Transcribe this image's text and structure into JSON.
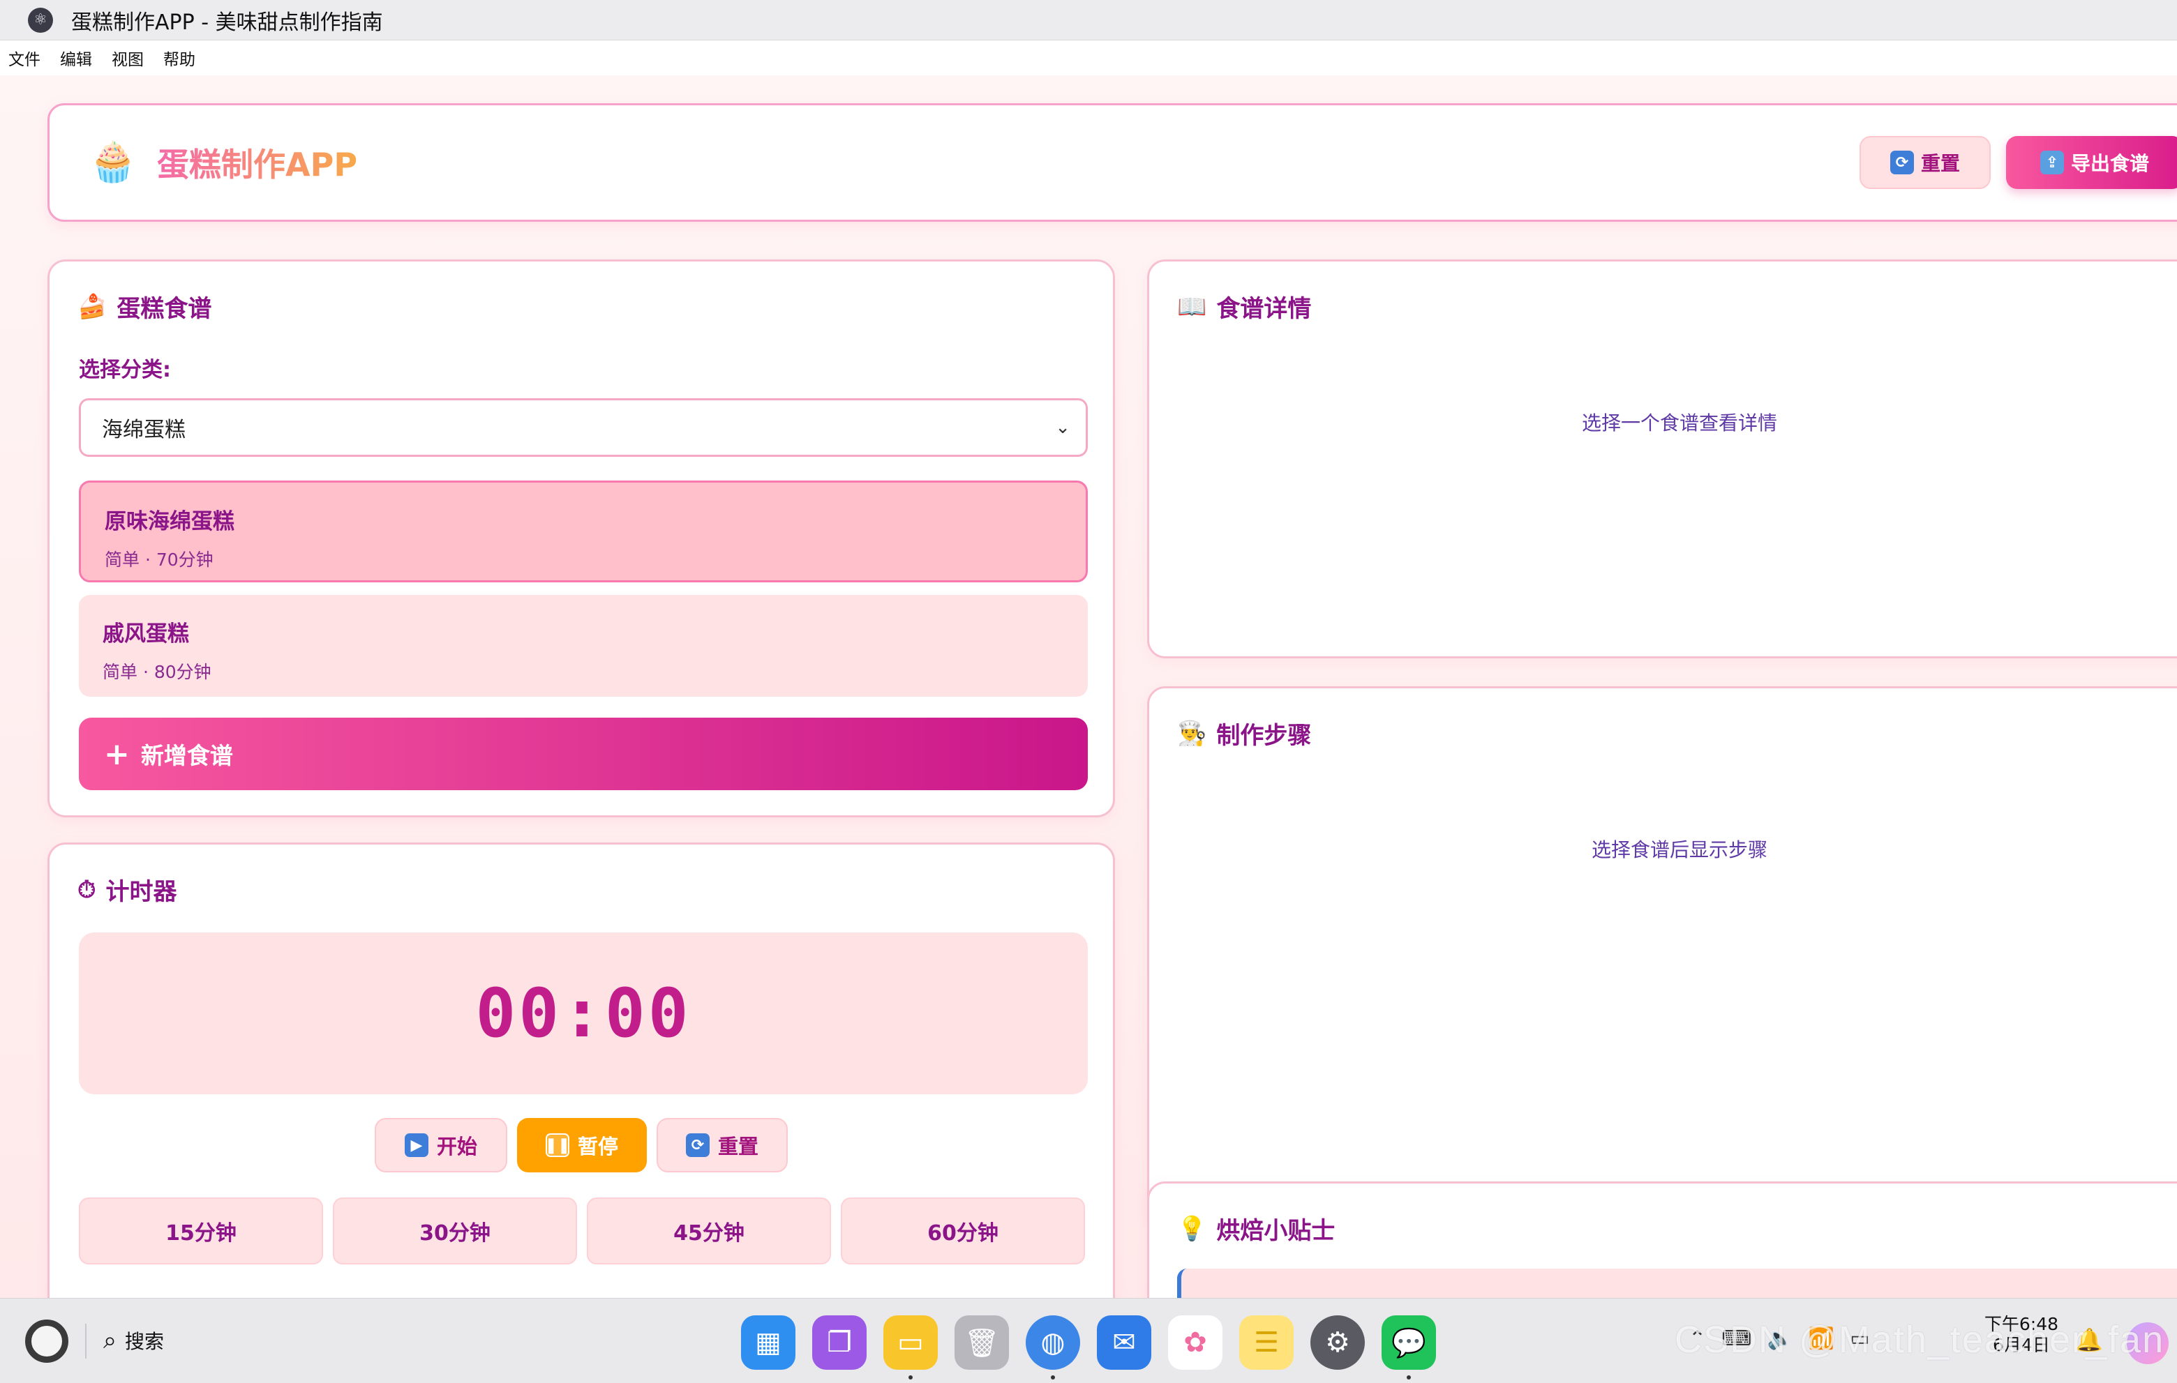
{
  "window": {
    "title": "蛋糕制作APP - 美味甜点制作指南"
  },
  "menu": [
    "文件",
    "编辑",
    "视图",
    "帮助"
  ],
  "header": {
    "logo_icon": "cupcake-icon",
    "app_title": "蛋糕制作APP",
    "reset_label": "重置",
    "export_label": "导出食谱"
  },
  "recipes": {
    "title": "蛋糕食谱",
    "category_label": "选择分类:",
    "category_value": "海绵蛋糕",
    "items": [
      {
        "name": "原味海绵蛋糕",
        "meta": "简单 · 70分钟",
        "selected": true
      },
      {
        "name": "戚风蛋糕",
        "meta": "简单 · 80分钟",
        "selected": false
      }
    ],
    "add_label": "新增食谱"
  },
  "timer": {
    "title": "计时器",
    "display": "00:00",
    "start_label": "开始",
    "pause_label": "暂停",
    "reset_label": "重置",
    "presets": [
      "15分钟",
      "30分钟",
      "45分钟",
      "60分钟"
    ]
  },
  "detail": {
    "title": "食谱详情",
    "placeholder": "选择一个食谱查看详情"
  },
  "steps": {
    "title": "制作步骤",
    "placeholder": "选择食谱后显示步骤"
  },
  "tips": {
    "title": "烘焙小贴士"
  },
  "taskbar": {
    "search_label": "搜索",
    "time": "下午6:48",
    "date": "6月4日",
    "watermark": "CSDN @Math_teacher_fan"
  },
  "colors": {
    "accent_pink": "#f7589f",
    "deep_magenta": "#c9168a",
    "pause_orange": "#ffa200",
    "title_purple": "#8a1488"
  }
}
